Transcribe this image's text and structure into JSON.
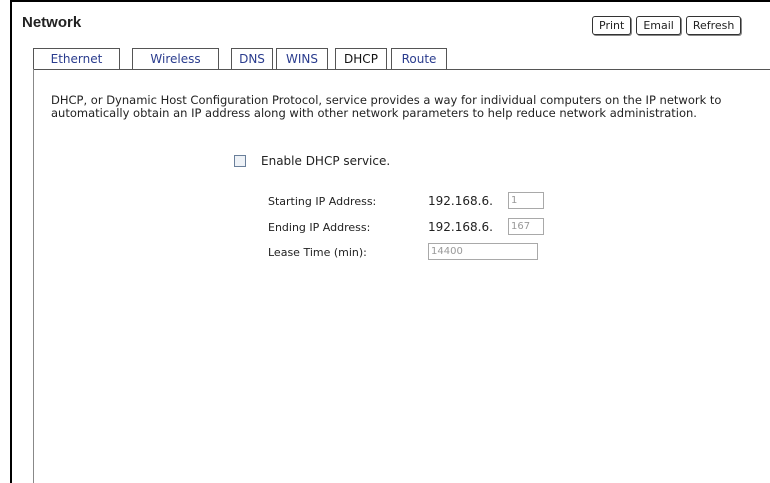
{
  "header": {
    "title": "Network",
    "buttons": {
      "print": "Print",
      "email": "Email",
      "refresh": "Refresh"
    }
  },
  "tabs": [
    {
      "label": "Ethernet",
      "active": false
    },
    {
      "label": "Wireless",
      "active": false
    },
    {
      "label": "DNS",
      "active": false
    },
    {
      "label": "WINS",
      "active": false
    },
    {
      "label": "DHCP",
      "active": true
    },
    {
      "label": "Route",
      "active": false
    }
  ],
  "main": {
    "description": "DHCP, or Dynamic Host Configuration Protocol, service provides a way for individual computers on the IP network to automatically obtain an IP address along with other network parameters to help reduce network administration.",
    "enable": {
      "label": "Enable DHCP service.",
      "checked": false
    },
    "fields": {
      "start": {
        "label": "Starting IP Address:",
        "prefix": "192.168.6.",
        "value": "1"
      },
      "end": {
        "label": "Ending IP Address:",
        "prefix": "192.168.6.",
        "value": "167"
      },
      "lease": {
        "label": "Lease Time (min):",
        "value": "14400"
      }
    }
  },
  "colors": {
    "tab_text": "#2a3c8e",
    "border": "#555555"
  }
}
